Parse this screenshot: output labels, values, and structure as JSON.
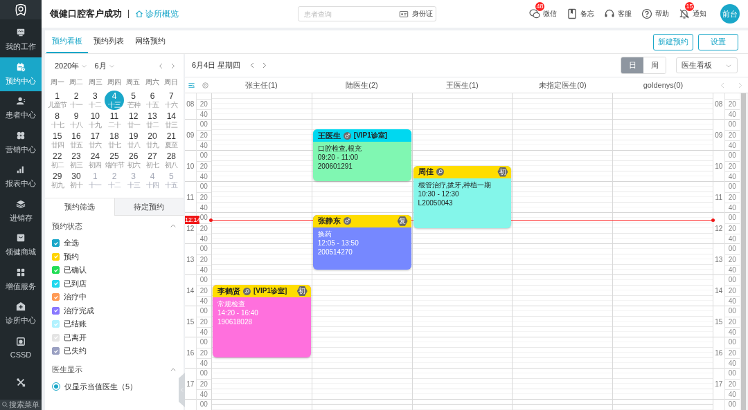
{
  "app": {
    "title": "领健口腔客户成功",
    "breadcrumb": "诊所概览"
  },
  "search": {
    "placeholder": "患者查询",
    "id_card_label": "身份证"
  },
  "toolbar": [
    {
      "kind": "wechat",
      "label": "微信",
      "badge": "48"
    },
    {
      "kind": "memo",
      "label": "备忘"
    },
    {
      "kind": "service",
      "label": "客服"
    },
    {
      "kind": "help",
      "label": "帮助"
    },
    {
      "kind": "notice",
      "label": "通知",
      "badge": "15"
    }
  ],
  "user": {
    "avatar_text": "前台"
  },
  "sidebar": {
    "items": [
      {
        "kind": "work",
        "label": "我的工作",
        "selected": false
      },
      {
        "kind": "appointment",
        "label": "预约中心",
        "selected": true
      },
      {
        "kind": "patient",
        "label": "患者中心",
        "selected": false
      },
      {
        "kind": "marketing",
        "label": "营销中心",
        "selected": false
      },
      {
        "kind": "report",
        "label": "报表中心",
        "selected": false
      },
      {
        "kind": "inventory",
        "label": "进销存",
        "selected": false
      },
      {
        "kind": "mall",
        "label": "领健商城",
        "selected": false
      },
      {
        "kind": "services",
        "label": "增值服务",
        "selected": false
      },
      {
        "kind": "clinic",
        "label": "诊所中心",
        "selected": false
      },
      {
        "kind": "cssd",
        "label": "CSSD",
        "selected": false
      },
      {
        "kind": "tools",
        "selected": false
      }
    ],
    "search_placeholder": "搜索菜单"
  },
  "tabs": [
    {
      "label": "预约看板",
      "selected": true
    },
    {
      "label": "预约列表",
      "selected": false
    },
    {
      "label": "网络预约",
      "selected": false
    }
  ],
  "actions": [
    "新建预约",
    "设置"
  ],
  "mini_calendar": {
    "year": "2020年",
    "month": "6月",
    "weekdays": [
      "周一",
      "周二",
      "周三",
      "周四",
      "周五",
      "周六",
      "周日"
    ],
    "weeks": [
      [
        {
          "day": "1",
          "lunar": "儿童节",
          "selected": false,
          "other_month": false
        },
        {
          "day": "2",
          "lunar": "十一",
          "selected": false,
          "other_month": false
        },
        {
          "day": "3",
          "lunar": "十二",
          "selected": false,
          "other_month": false
        },
        {
          "day": "4",
          "lunar": "十三",
          "selected": true,
          "other_month": false
        },
        {
          "day": "5",
          "lunar": "芒种",
          "selected": false,
          "other_month": false
        },
        {
          "day": "6",
          "lunar": "十五",
          "selected": false,
          "other_month": false
        },
        {
          "day": "7",
          "lunar": "十六",
          "selected": false,
          "other_month": false
        }
      ],
      [
        {
          "day": "8",
          "lunar": "十七",
          "selected": false,
          "other_month": false
        },
        {
          "day": "9",
          "lunar": "十八",
          "selected": false,
          "other_month": false
        },
        {
          "day": "10",
          "lunar": "十九",
          "selected": false,
          "other_month": false
        },
        {
          "day": "11",
          "lunar": "二十",
          "selected": false,
          "other_month": false
        },
        {
          "day": "12",
          "lunar": "廿一",
          "selected": false,
          "other_month": false
        },
        {
          "day": "13",
          "lunar": "廿二",
          "selected": false,
          "other_month": false
        },
        {
          "day": "14",
          "lunar": "廿三",
          "selected": false,
          "other_month": false
        }
      ],
      [
        {
          "day": "15",
          "lunar": "廿四",
          "selected": false,
          "other_month": false
        },
        {
          "day": "16",
          "lunar": "廿五",
          "selected": false,
          "other_month": false
        },
        {
          "day": "17",
          "lunar": "廿六",
          "selected": false,
          "other_month": false
        },
        {
          "day": "18",
          "lunar": "廿七",
          "selected": false,
          "other_month": false
        },
        {
          "day": "19",
          "lunar": "廿八",
          "selected": false,
          "other_month": false
        },
        {
          "day": "20",
          "lunar": "廿九",
          "selected": false,
          "other_month": false
        },
        {
          "day": "21",
          "lunar": "夏至",
          "selected": false,
          "other_month": false
        }
      ],
      [
        {
          "day": "22",
          "lunar": "初二",
          "selected": false,
          "other_month": false
        },
        {
          "day": "23",
          "lunar": "初三",
          "selected": false,
          "other_month": false
        },
        {
          "day": "24",
          "lunar": "初四",
          "selected": false,
          "other_month": false
        },
        {
          "day": "25",
          "lunar": "端午节",
          "selected": false,
          "other_month": false
        },
        {
          "day": "26",
          "lunar": "初六",
          "selected": false,
          "other_month": false
        },
        {
          "day": "27",
          "lunar": "初七",
          "selected": false,
          "other_month": false
        },
        {
          "day": "28",
          "lunar": "初八",
          "selected": false,
          "other_month": false
        }
      ],
      [
        {
          "day": "29",
          "lunar": "初九",
          "selected": false,
          "other_month": false
        },
        {
          "day": "30",
          "lunar": "初十",
          "selected": false,
          "other_month": false
        },
        {
          "day": "1",
          "lunar": "十一",
          "selected": false,
          "other_month": true
        },
        {
          "day": "2",
          "lunar": "十二",
          "selected": false,
          "other_month": true
        },
        {
          "day": "3",
          "lunar": "十三",
          "selected": false,
          "other_month": true
        },
        {
          "day": "4",
          "lunar": "十四",
          "selected": false,
          "other_month": true
        },
        {
          "day": "5",
          "lunar": "十五",
          "selected": false,
          "other_month": true
        }
      ]
    ]
  },
  "filter_tabs": [
    {
      "label": "预约筛选",
      "selected": true
    },
    {
      "label": "待定预约",
      "selected": false
    }
  ],
  "status_section": {
    "title": "预约状态",
    "expanded": true,
    "items": [
      {
        "label": "全选",
        "checked": true,
        "color": "#1aa7c9"
      },
      {
        "label": "预约",
        "checked": true,
        "color": "#ffd400"
      },
      {
        "label": "已确认",
        "checked": true,
        "color": "#22dd55"
      },
      {
        "label": "已到店",
        "checked": true,
        "color": "#22d8ee"
      },
      {
        "label": "治疗中",
        "checked": true,
        "color": "#ff9a55"
      },
      {
        "label": "治疗完成",
        "checked": true,
        "color": "#8a78ff"
      },
      {
        "label": "已结账",
        "checked": true,
        "color": "#b2f2ff"
      },
      {
        "label": "已离开",
        "checked": true,
        "color": "#e4e4e4"
      },
      {
        "label": "已失约",
        "checked": true,
        "color": "#9aa0c2"
      }
    ]
  },
  "doctor_section": {
    "title": "医生显示",
    "expanded": true,
    "options": [
      {
        "label": "仅显示当值医生（5）",
        "selected": true
      }
    ]
  },
  "schedule": {
    "date": "6月4日 星期四",
    "views": [
      {
        "label": "日",
        "selected": true
      },
      {
        "label": "周",
        "selected": false
      }
    ],
    "board_select": "医生看板",
    "columns": [
      {
        "name": "张主任(1)",
        "appointments": [
          {
            "patient": "李鹤贤",
            "kind": "female",
            "room": "[VIP1诊室]",
            "badge": "初",
            "header": {
              "color": "#ffdd00"
            },
            "color": "#ff70dd",
            "treatment": "常规检查",
            "time": "14:20 - 16:40",
            "record_no": "190618028"
          }
        ]
      },
      {
        "name": "陆医生(2)",
        "appointments": [
          {
            "patient": "王医生",
            "kind": "male",
            "room": "[VIP1诊室]",
            "header": {
              "color": "#00d8f0"
            },
            "color": "#80f7b2",
            "treatment": "口腔检查,根充",
            "time": "09:20 - 11:00",
            "record_no": "200601291"
          },
          {
            "patient": "张静东",
            "kind": "male",
            "badge": "复",
            "header": {
              "color": "#ffdd00"
            },
            "color": "#7688ff",
            "treatment": "换药",
            "time": "12:05 - 13:50",
            "record_no": "200514270"
          }
        ]
      },
      {
        "name": "王医生(1)",
        "appointments": [
          {
            "patient": "周佳",
            "kind": "female",
            "badge": "初",
            "header": {
              "color": "#ffdd00"
            },
            "color": "#84f6ea",
            "treatment": "根管治疗,拔牙,种植一期",
            "time": "10:30 - 12:30",
            "record_no": "L20050043"
          }
        ]
      },
      {
        "name": "未指定医生(0)"
      },
      {
        "name": "goldenys(0)"
      }
    ],
    "time_axis_left": [
      {
        "hour": "08",
        "minutes": [
          "20",
          "40"
        ]
      },
      {
        "hour": "09",
        "minutes": [
          "00",
          "20",
          "40"
        ]
      },
      {
        "hour": "10",
        "minutes": [
          "00",
          "20",
          "40"
        ]
      },
      {
        "hour": "11",
        "minutes": [
          "00",
          "20",
          "40"
        ]
      },
      {
        "hour": "12",
        "minutes": [
          "00",
          "20",
          "40"
        ]
      },
      {
        "hour": "13",
        "minutes": [
          "00",
          "20",
          "40"
        ]
      },
      {
        "hour": "14",
        "minutes": [
          "00",
          "20",
          "40"
        ]
      },
      {
        "hour": "15",
        "minutes": [
          "00",
          "20",
          "40"
        ]
      },
      {
        "hour": "16",
        "minutes": [
          "00",
          "20",
          "40"
        ]
      },
      {
        "hour": "17",
        "minutes": [
          "00",
          "20",
          "40"
        ]
      },
      {
        "minutes": [
          "00"
        ]
      }
    ],
    "time_axis_right": [
      {
        "hour": "08",
        "minutes": [
          "20",
          "40"
        ]
      },
      {
        "hour": "09",
        "minutes": [
          "00",
          "20",
          "40"
        ]
      },
      {
        "hour": "10",
        "minutes": [
          "00",
          "20",
          "40"
        ]
      },
      {
        "hour": "11",
        "minutes": [
          "00",
          "20",
          "40"
        ]
      },
      {
        "hour": "12",
        "minutes": [
          "00",
          "20",
          "40"
        ]
      },
      {
        "hour": "13",
        "minutes": [
          "00",
          "20",
          "40"
        ]
      },
      {
        "hour": "14",
        "minutes": [
          "00",
          "20",
          "40"
        ]
      },
      {
        "hour": "15",
        "minutes": [
          "00",
          "20",
          "40"
        ]
      },
      {
        "hour": "16",
        "minutes": [
          "00",
          "20",
          "40"
        ]
      },
      {
        "hour": "17",
        "minutes": [
          "00",
          "20",
          "40"
        ]
      },
      {
        "minutes": [
          "00"
        ]
      }
    ],
    "now": "12:14"
  }
}
